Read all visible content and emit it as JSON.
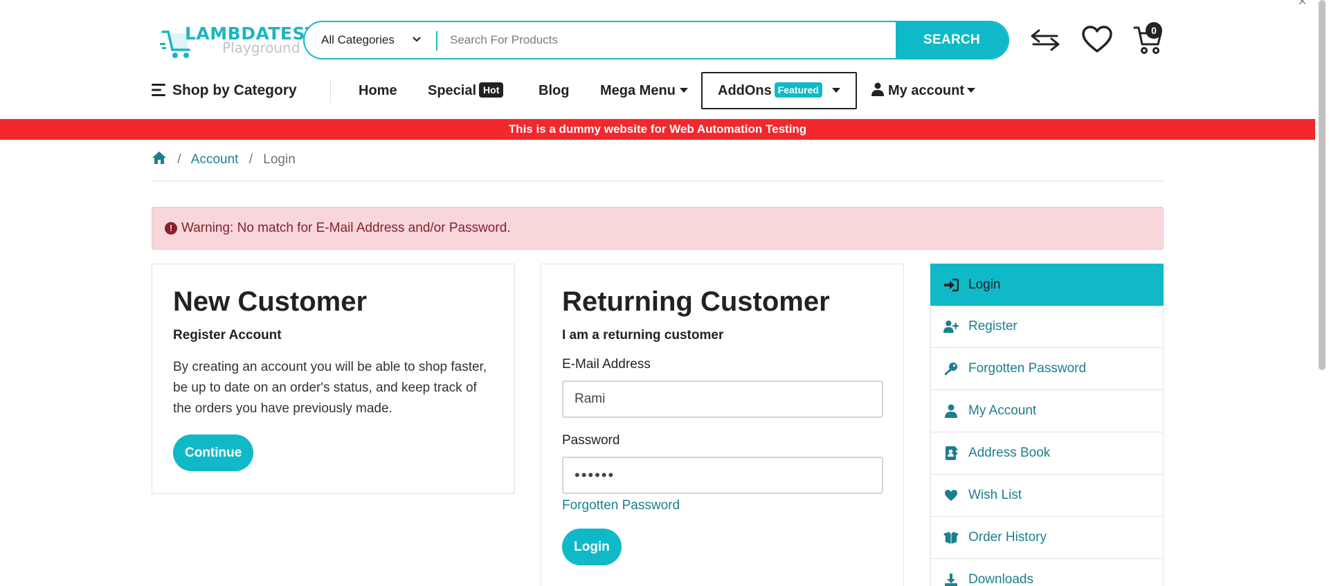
{
  "logo": {
    "title": "LAMBDATEST",
    "subtitle": "Playground"
  },
  "search": {
    "category": "All Categories",
    "placeholder": "Search For Products",
    "button": "SEARCH"
  },
  "cart": {
    "count": "0"
  },
  "nav": {
    "shop_by_category": "Shop by Category",
    "home": "Home",
    "special": "Special",
    "special_badge": "Hot",
    "blog": "Blog",
    "mega_menu": "Mega Menu",
    "addons": "AddOns",
    "addons_badge": "Featured",
    "my_account": "My account"
  },
  "banner": "This is a dummy website for Web Automation Testing",
  "breadcrumb": {
    "account": "Account",
    "current": "Login"
  },
  "alert": "Warning: No match for E-Mail Address and/or Password.",
  "new_customer": {
    "title": "New Customer",
    "subtitle": "Register Account",
    "body": "By creating an account you will be able to shop faster, be up to date on an order's status, and keep track of the orders you have previously made.",
    "button": "Continue"
  },
  "returning_customer": {
    "title": "Returning Customer",
    "subtitle": "I am a returning customer",
    "email_label": "E-Mail Address",
    "email_value": "Rami",
    "password_label": "Password",
    "password_value": "••••••",
    "forgotten": "Forgotten Password",
    "button": "Login"
  },
  "sidemenu": [
    {
      "label": "Login",
      "icon": "sign-in-icon"
    },
    {
      "label": "Register",
      "icon": "user-plus-icon"
    },
    {
      "label": "Forgotten Password",
      "icon": "key-icon"
    },
    {
      "label": "My Account",
      "icon": "user-icon"
    },
    {
      "label": "Address Book",
      "icon": "address-book-icon"
    },
    {
      "label": "Wish List",
      "icon": "heart-icon"
    },
    {
      "label": "Order History",
      "icon": "box-open-icon"
    },
    {
      "label": "Downloads",
      "icon": "download-icon"
    }
  ],
  "colors": {
    "accent": "#10b9c8",
    "banner": "#f2282c",
    "link": "#1a7f8f",
    "alert_bg": "#f8d7da",
    "alert_text": "#842029"
  }
}
